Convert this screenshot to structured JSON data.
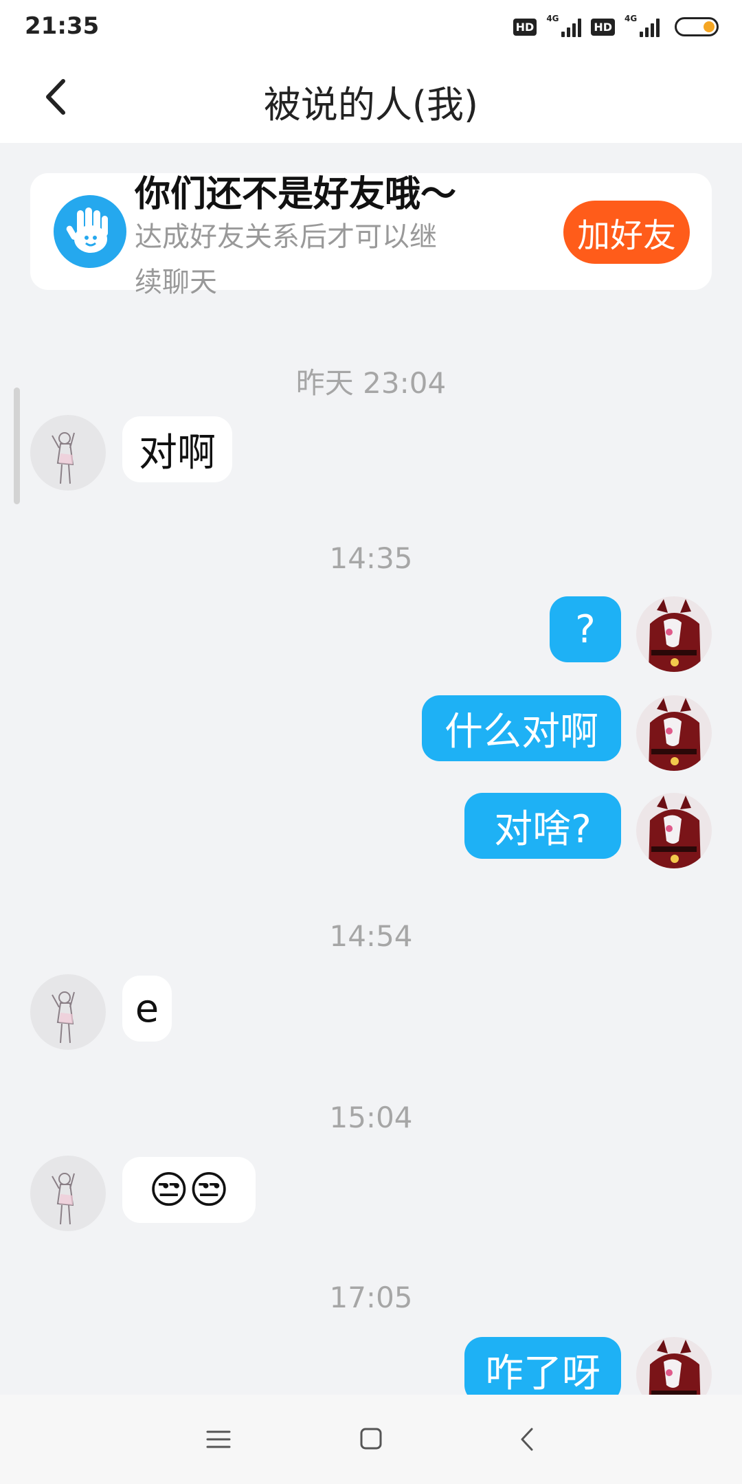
{
  "status_bar": {
    "time": "21:35",
    "hd_label": "HD",
    "network_label": "4G",
    "battery_color": "#F5A623"
  },
  "header": {
    "title": "被说的人(我)",
    "back_icon": "chevron-left-icon"
  },
  "friend_notice": {
    "title": "你们还不是好友哦～",
    "description": "达成好友关系后才可以继续聊天",
    "button_label": "加好友",
    "icon": "waving-hand-icon",
    "button_color": "#FF5C1A"
  },
  "messages": [
    {
      "type": "time",
      "text": "昨天 23:04"
    },
    {
      "type": "in",
      "text": "对啊"
    },
    {
      "type": "time",
      "text": "14:35"
    },
    {
      "type": "out",
      "text": "?"
    },
    {
      "type": "out",
      "text": "什么对啊"
    },
    {
      "type": "out",
      "text": "对啥?"
    },
    {
      "type": "time",
      "text": "14:54"
    },
    {
      "type": "in",
      "text": "e"
    },
    {
      "type": "time",
      "text": "15:04"
    },
    {
      "type": "in",
      "text": "😒😒"
    },
    {
      "type": "time",
      "text": "17:05"
    },
    {
      "type": "out",
      "text": "咋了呀"
    }
  ],
  "colors": {
    "outgoing_bubble": "#1EB1F5",
    "incoming_bubble": "#FFFFFF",
    "chat_background": "#F2F3F5"
  },
  "nav_bar": {
    "icons": [
      "menu-icon",
      "home-icon",
      "back-icon"
    ]
  }
}
